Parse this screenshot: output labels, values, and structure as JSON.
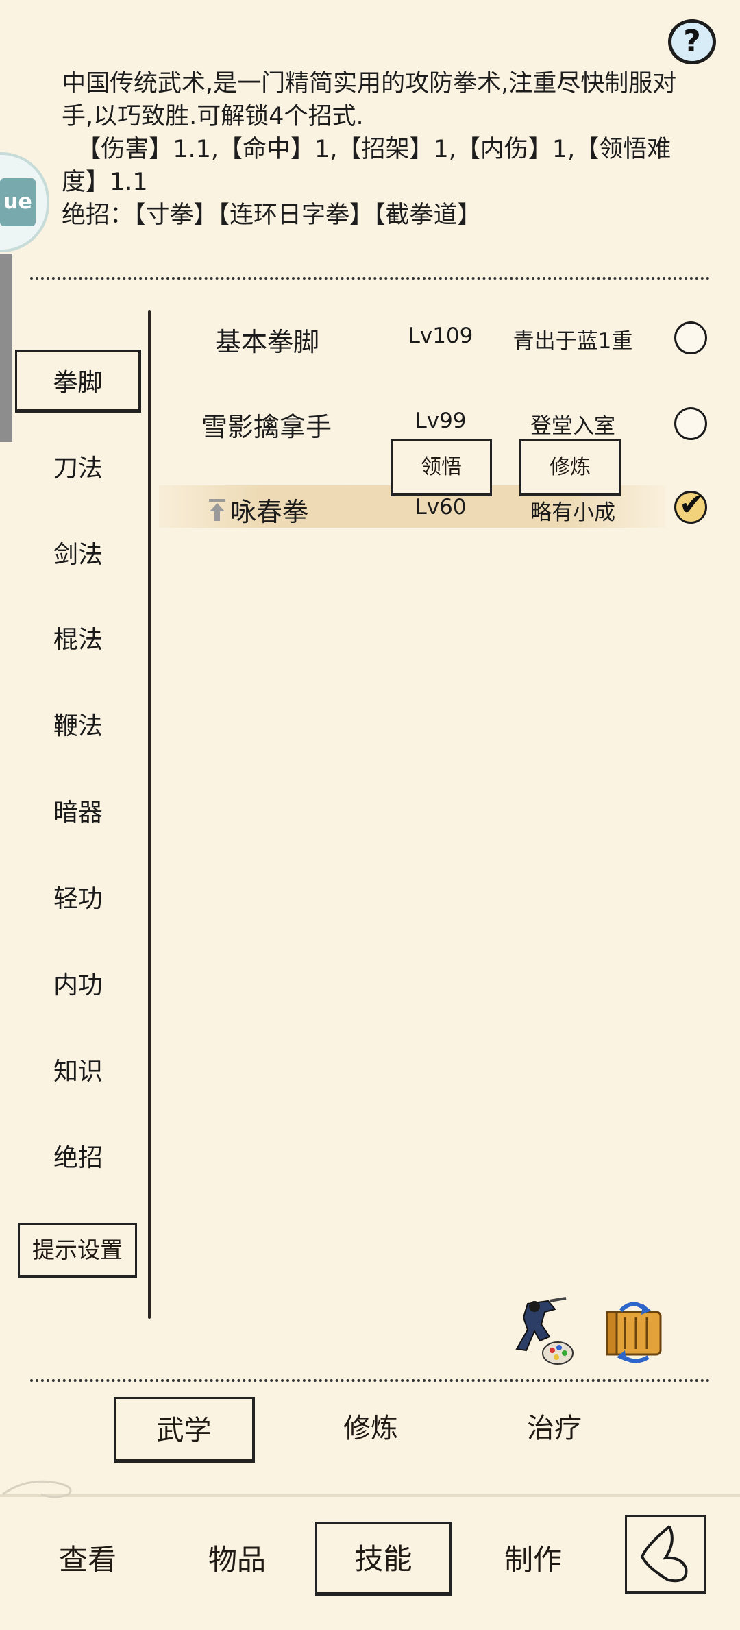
{
  "help": {
    "label": "?"
  },
  "description": {
    "text": "中国传统武术,是一门精简实用的攻防拳术,注重尽快制服对手,以巧致胜.可解锁4个招式.\n  【伤害】1.1,【命中】1,【招架】1,【内伤】1,【领悟难度】1.1\n绝招：【寸拳】【连环日字拳】【截拳道】"
  },
  "side_widget": {
    "label": "ue"
  },
  "categories": [
    {
      "label": "拳脚",
      "active": true
    },
    {
      "label": "刀法"
    },
    {
      "label": "剑法"
    },
    {
      "label": "棍法"
    },
    {
      "label": "鞭法"
    },
    {
      "label": "暗器"
    },
    {
      "label": "轻功"
    },
    {
      "label": "内功"
    },
    {
      "label": "知识"
    },
    {
      "label": "绝招"
    }
  ],
  "hint_settings": "提示设置",
  "skills": [
    {
      "name": "基本拳脚",
      "level": "Lv109",
      "rank": "青出于蓝1重",
      "selected": false
    },
    {
      "name": "雪影擒拿手",
      "level": "Lv99",
      "rank": "登堂入室",
      "selected": false
    },
    {
      "name": "咏春拳",
      "level": "Lv60",
      "rank": "略有小成",
      "selected": true
    }
  ],
  "skill_actions": {
    "comprehend": "领悟",
    "train": "修炼"
  },
  "icons": {
    "martial_art_icon": "fighter-palette-icon",
    "scroll_icon": "scroll-swap-icon"
  },
  "subtabs": [
    {
      "label": "武学",
      "active": true
    },
    {
      "label": "修炼"
    },
    {
      "label": "治疗"
    }
  ],
  "nav": [
    {
      "label": "查看"
    },
    {
      "label": "物品"
    },
    {
      "label": "技能",
      "active": true
    },
    {
      "label": "制作"
    }
  ],
  "colors": {
    "background": "#fbf3e2",
    "highlight": "#ecd8b0",
    "help_bg": "#d7ecf7"
  }
}
